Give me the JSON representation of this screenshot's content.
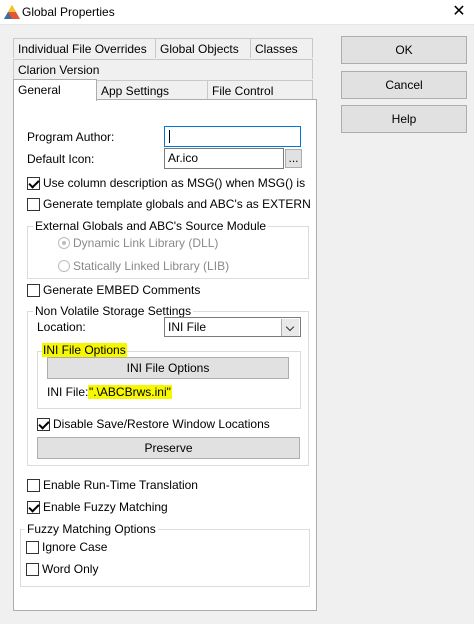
{
  "window": {
    "title": "Global Properties",
    "close_glyph": "✕",
    "app_icon": "clarion-triangle-icon"
  },
  "tabs": {
    "row1": [
      "Individual File Overrides",
      "Global Objects",
      "Classes"
    ],
    "row2": [
      "Clarion Version"
    ],
    "row3": [
      "General",
      "App Settings",
      "File Control"
    ]
  },
  "general": {
    "program_author_label": "Program Author:",
    "program_author_value": "",
    "default_icon_label": "Default Icon:",
    "default_icon_value": "Ar.ico",
    "browse_label": "...",
    "use_column_desc": {
      "label": "Use column description as MSG() when MSG() is bla",
      "checked": true
    },
    "gen_template_globals": {
      "label": "Generate template globals and ABC's as EXTERNAL",
      "checked": false
    },
    "external_group": {
      "title": "External Globals and ABC's Source Module",
      "options": [
        {
          "label": "Dynamic Link Library (DLL)",
          "selected": true
        },
        {
          "label": "Statically Linked Library (LIB)",
          "selected": false
        }
      ]
    },
    "gen_embed_comments": {
      "label": "Generate EMBED Comments",
      "checked": false
    },
    "nvs_group": {
      "title": "Non Volatile Storage Settings",
      "location_label": "Location:",
      "location_value": "INI File",
      "ini_options_title": "INI File Options",
      "ini_options_button": "INI File Options",
      "ini_file_label": "INI File:",
      "ini_file_value": "\".\\ABCBrws.ini\"",
      "disable_save_restore": {
        "label": "Disable Save/Restore Window Locations",
        "checked": true
      },
      "preserve_button": "Preserve"
    },
    "enable_runtime_translation": {
      "label": "Enable Run-Time Translation",
      "checked": false
    },
    "enable_fuzzy_matching": {
      "label": "Enable Fuzzy Matching",
      "checked": true
    },
    "fuzzy_group": {
      "title": "Fuzzy Matching Options",
      "ignore_case": {
        "label": "Ignore Case",
        "checked": false
      },
      "word_only": {
        "label": "Word Only",
        "checked": false
      }
    }
  },
  "side_buttons": {
    "ok": "OK",
    "cancel": "Cancel",
    "help": "Help"
  },
  "colors": {
    "highlight": "#f7f700",
    "focus_border": "#0078d7"
  }
}
